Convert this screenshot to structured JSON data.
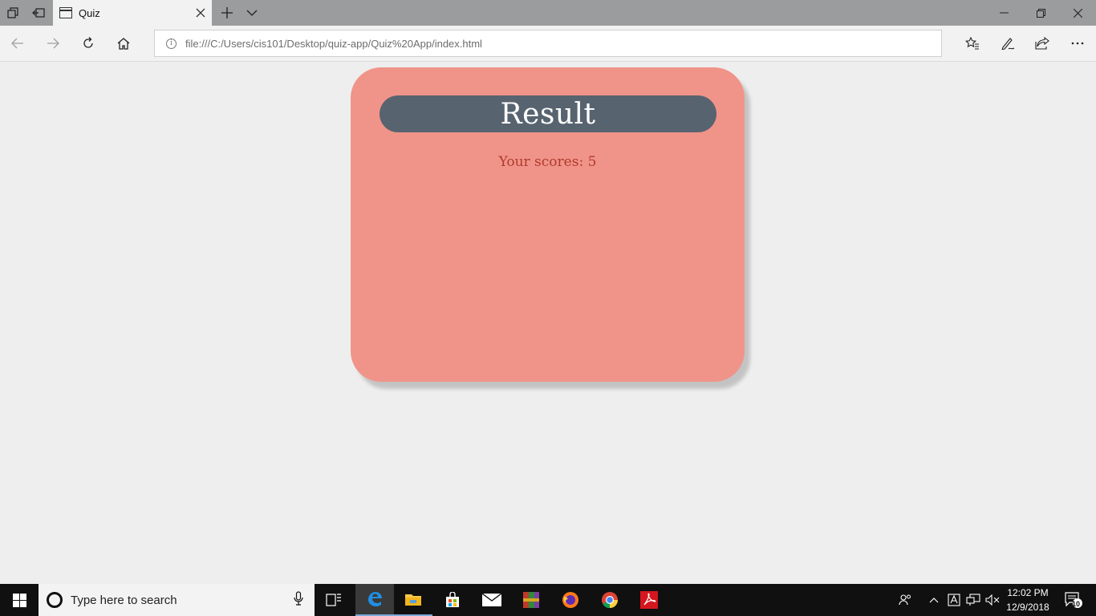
{
  "browser": {
    "tab": {
      "title": "Quiz"
    },
    "address_bar": {
      "url": "file:///C:/Users/cis101/Desktop/quiz-app/Quiz%20App/index.html"
    }
  },
  "page": {
    "result_title": "Result",
    "score_text": "Your scores: 5"
  },
  "taskbar": {
    "search_placeholder": "Type here to search",
    "apps": [
      "task-view",
      "edge",
      "file-explorer",
      "store",
      "mail",
      "winrar",
      "firefox",
      "chrome",
      "acrobat"
    ],
    "clock": {
      "time": "12:02 PM",
      "date": "12/9/2018"
    },
    "notification_count": "10"
  },
  "colors": {
    "card": "#f09489",
    "result_pill": "#586370",
    "score_text": "#b03a2e",
    "page_bg": "#eeeeee"
  }
}
